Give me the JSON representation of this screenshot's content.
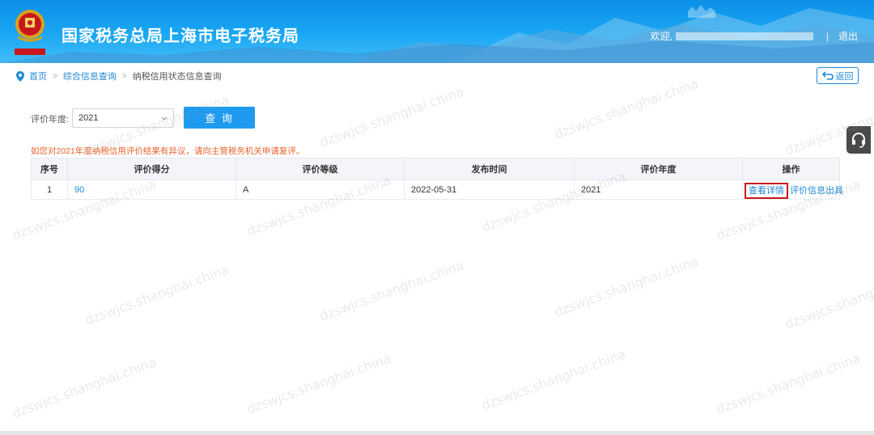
{
  "header": {
    "site_title": "国家税务总局上海市电子税务局",
    "welcome": "欢迎,",
    "separator": "|",
    "logout": "退出"
  },
  "breadcrumb": {
    "home": "首页",
    "level2": "综合信息查询",
    "current": "纳税信用状态信息查询"
  },
  "back_button": "返回",
  "filter": {
    "label": "评价年度:",
    "year_value": "2021",
    "query_button": "查 询"
  },
  "notice": "如您对2021年度纳税信用评价结果有异议，请向主管税务机关申请复评。",
  "table": {
    "columns": [
      "序号",
      "评价得分",
      "评价等级",
      "发布时间",
      "评价年度",
      "操作"
    ],
    "rows": [
      {
        "index": "1",
        "score": "90",
        "grade": "A",
        "publish_date": "2022-05-31",
        "year": "2021",
        "action_detail": "查看详情",
        "action_issue": "评价信息出具"
      }
    ]
  },
  "watermark": "dzswjcs.shanghai.china",
  "colors": {
    "brand_blue": "#1e9bef",
    "link_blue": "#1e88d6",
    "notice_orange": "#e8632b",
    "highlight_red": "#c8161d"
  },
  "icons": {
    "emblem": "tax-emblem-icon",
    "location": "location-pin-icon",
    "back": "return-arrow-icon",
    "service": "headset-icon",
    "select": "chevron-down-icon"
  }
}
